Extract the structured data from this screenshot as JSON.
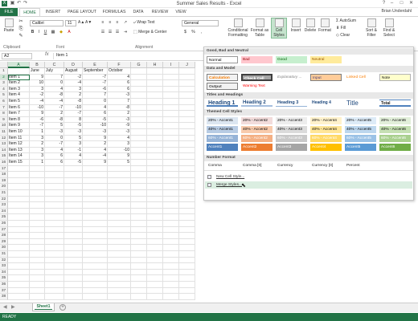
{
  "app": {
    "title": "Summer Sales Results - Excel",
    "user": "Brian Underdahl"
  },
  "tabs": [
    "FILE",
    "HOME",
    "INSERT",
    "PAGE LAYOUT",
    "FORMULAS",
    "DATA",
    "REVIEW",
    "VIEW"
  ],
  "ribbon": {
    "font_name": "Calibri",
    "font_size": "11",
    "number_format": "General",
    "wrap_text": "Wrap Text",
    "merge_center": "Merge & Center",
    "conditional_formatting": "Conditional Formatting",
    "format_as_table": "Format as Table",
    "cell_styles": "Cell Styles",
    "insert": "Insert",
    "delete": "Delete",
    "format": "Format",
    "autosum": "AutoSum",
    "fill": "Fill",
    "clear": "Clear",
    "sort_filter": "Sort & Filter",
    "find_select": "Find & Select",
    "paste": "Paste",
    "groups": {
      "clipboard": "Clipboard",
      "font": "Font",
      "alignment": "Alignment"
    }
  },
  "formula_bar": {
    "name_box": "A2",
    "fx": "fx",
    "value": "Item 1"
  },
  "sheet": {
    "columns": [
      "A",
      "B",
      "C",
      "D",
      "E",
      "F",
      "G",
      "H",
      "I",
      "J"
    ],
    "rows": [
      "1",
      "2",
      "3",
      "4",
      "5",
      "6",
      "7",
      "8",
      "9",
      "10",
      "11",
      "12",
      "13",
      "14",
      "15",
      "16",
      "17",
      "18",
      "19",
      "20",
      "21",
      "22",
      "23",
      "24",
      "25",
      "26",
      "27",
      "28",
      "29",
      "30",
      "31",
      "32",
      "33",
      "34",
      "35",
      "36",
      "37",
      "38"
    ],
    "headers": [
      "",
      "June",
      "July",
      "August",
      "September",
      "October"
    ],
    "data": [
      [
        "Item 1",
        "9",
        "7",
        "-2",
        "-7",
        "4"
      ],
      [
        "Item 2",
        "10",
        "0",
        "-4",
        "-7",
        "6"
      ],
      [
        "Item 3",
        "3",
        "4",
        "3",
        "-6",
        "6"
      ],
      [
        "Item 4",
        "-2",
        "-8",
        "2",
        "7",
        "-3"
      ],
      [
        "Item 5",
        "-4",
        "-4",
        "-8",
        "0",
        "7"
      ],
      [
        "Item 6",
        "-10",
        "-7",
        "-10",
        "4",
        "-8"
      ],
      [
        "Item 7",
        "9",
        "2",
        "-7",
        "6",
        "2"
      ],
      [
        "Item 8",
        "-6",
        "-8",
        "8",
        "-5",
        "-3"
      ],
      [
        "Item 9",
        "-7",
        "5",
        "-5",
        "-10",
        "-9"
      ],
      [
        "Item 10",
        "1",
        "-3",
        "-3",
        "-3",
        "-3"
      ],
      [
        "Item 11",
        "3",
        "0",
        "5",
        "9",
        "4"
      ],
      [
        "Item 12",
        "2",
        "-7",
        "3",
        "2",
        "3"
      ],
      [
        "Item 13",
        "3",
        "4",
        "-1",
        "4",
        "-10"
      ],
      [
        "Item 14",
        "3",
        "6",
        "4",
        "-4",
        "9"
      ],
      [
        "Item 15",
        "1",
        "6",
        "-5",
        "9",
        "5"
      ]
    ]
  },
  "sheet_tab": "Sheet1",
  "status": "READY",
  "gallery": {
    "sections": {
      "good_bad": "Good, Bad and Neutral",
      "data_model": "Data and Model",
      "titles": "Titles and Headings",
      "themed": "Themed Cell Styles",
      "number_format": "Number Format"
    },
    "good_bad": [
      {
        "label": "Normal",
        "bg": "#ffffff",
        "fg": "#000000"
      },
      {
        "label": "Bad",
        "bg": "#ffc7ce",
        "fg": "#9c0006"
      },
      {
        "label": "Good",
        "bg": "#c6efce",
        "fg": "#006100"
      },
      {
        "label": "Neutral",
        "bg": "#ffeb9c",
        "fg": "#9c5700"
      }
    ],
    "data_model": [
      {
        "label": "Calculation",
        "bg": "#f2f2f2",
        "fg": "#fa7d00"
      },
      {
        "label": "Check Cell",
        "bg": "#a5a5a5",
        "fg": "#ffffff"
      },
      {
        "label": "Explanatory ...",
        "bg": "#ffffff",
        "fg": "#7f7f7f"
      },
      {
        "label": "Input",
        "bg": "#ffcc99",
        "fg": "#3f3f76"
      },
      {
        "label": "Linked Cell",
        "bg": "#ffffff",
        "fg": "#fa7d00"
      },
      {
        "label": "Note",
        "bg": "#ffffcc",
        "fg": "#000000"
      },
      {
        "label": "Output",
        "bg": "#f2f2f2",
        "fg": "#3f3f3f"
      },
      {
        "label": "Warning Text",
        "bg": "#ffffff",
        "fg": "#ff0000"
      }
    ],
    "titles": [
      "Heading 1",
      "Heading 2",
      "Heading 3",
      "Heading 4",
      "Title",
      "Total"
    ],
    "themed": [
      {
        "label": "20% - Accent1",
        "bg": "#dce6f1",
        "fg": "#000"
      },
      {
        "label": "20% - Accent2",
        "bg": "#f2dcdb",
        "fg": "#000"
      },
      {
        "label": "20% - Accent3",
        "bg": "#ededed",
        "fg": "#000"
      },
      {
        "label": "20% - Accent4",
        "bg": "#fff2cc",
        "fg": "#000"
      },
      {
        "label": "20% - Accent5",
        "bg": "#ddebf7",
        "fg": "#000"
      },
      {
        "label": "20% - Accent6",
        "bg": "#e2efda",
        "fg": "#000"
      },
      {
        "label": "40% - Accent1",
        "bg": "#b8cce4",
        "fg": "#000"
      },
      {
        "label": "40% - Accent2",
        "bg": "#f8cbad",
        "fg": "#000"
      },
      {
        "label": "40% - Accent3",
        "bg": "#dbdbdb",
        "fg": "#000"
      },
      {
        "label": "40% - Accent4",
        "bg": "#ffe699",
        "fg": "#000"
      },
      {
        "label": "40% - Accent5",
        "bg": "#bdd7ee",
        "fg": "#000"
      },
      {
        "label": "40% - Accent6",
        "bg": "#c6e0b4",
        "fg": "#000"
      },
      {
        "label": "60% - Accent1",
        "bg": "#95b3d7",
        "fg": "#fff"
      },
      {
        "label": "60% - Accent2",
        "bg": "#f4b084",
        "fg": "#fff"
      },
      {
        "label": "60% - Accent3",
        "bg": "#c9c9c9",
        "fg": "#fff"
      },
      {
        "label": "60% - Accent4",
        "bg": "#ffd966",
        "fg": "#fff"
      },
      {
        "label": "60% - Accent5",
        "bg": "#9bc2e6",
        "fg": "#fff"
      },
      {
        "label": "60% - Accent6",
        "bg": "#a9d08e",
        "fg": "#fff"
      },
      {
        "label": "Accent1",
        "bg": "#4f81bd",
        "fg": "#fff"
      },
      {
        "label": "Accent2",
        "bg": "#ed7d31",
        "fg": "#fff"
      },
      {
        "label": "Accent3",
        "bg": "#a5a5a5",
        "fg": "#fff"
      },
      {
        "label": "Accent4",
        "bg": "#ffc000",
        "fg": "#fff"
      },
      {
        "label": "Accent5",
        "bg": "#5b9bd5",
        "fg": "#fff"
      },
      {
        "label": "Accent6",
        "bg": "#70ad47",
        "fg": "#fff"
      }
    ],
    "number_format": [
      "Comma",
      "Comma [0]",
      "Currency",
      "Currency [0]",
      "Percent"
    ],
    "menu": [
      "New Cell Style...",
      "Merge Styles..."
    ]
  }
}
